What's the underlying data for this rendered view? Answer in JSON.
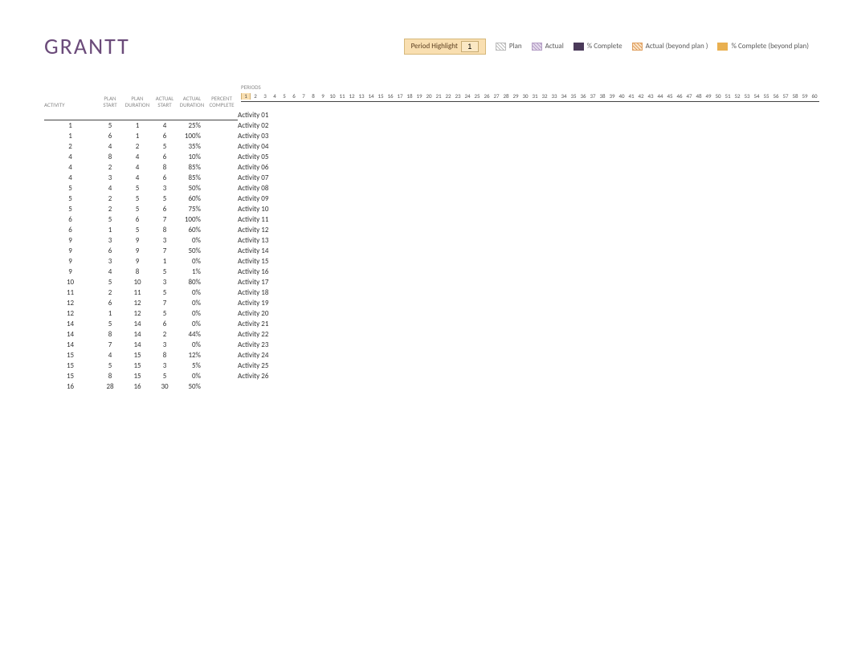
{
  "title": "GRANTT",
  "legend": {
    "highlight_label": "Period Highlight",
    "highlight_value": "1",
    "items": [
      {
        "swatch": "sw-plan",
        "label": "Plan"
      },
      {
        "swatch": "sw-actual",
        "label": "Actual"
      },
      {
        "swatch": "sw-complete",
        "label": "% Complete"
      },
      {
        "swatch": "sw-actual-beyond",
        "label": "Actual (beyond plan )"
      },
      {
        "swatch": "sw-complete-beyond",
        "label": "% Complete (beyond plan)"
      }
    ]
  },
  "columns": {
    "activity": "ACTIVITY",
    "plan_start": "PLAN\nSTART",
    "plan_duration": "PLAN\nDURATION",
    "actual_start": "ACTUAL\nSTART",
    "actual_duration": "ACTUAL\nDURATION",
    "percent_complete": "PERCENT\nCOMPLETE",
    "periods": "PERIODS"
  },
  "periods_count": 60,
  "highlight_period": 1,
  "rows": [
    {
      "activity": "Activity 01",
      "plan_start": "1",
      "plan_duration": "5",
      "actual_start": "1",
      "actual_duration": "4",
      "percent": "25%"
    },
    {
      "activity": "Activity 02",
      "plan_start": "1",
      "plan_duration": "6",
      "actual_start": "1",
      "actual_duration": "6",
      "percent": "100%"
    },
    {
      "activity": "Activity 03",
      "plan_start": "2",
      "plan_duration": "4",
      "actual_start": "2",
      "actual_duration": "5",
      "percent": "35%"
    },
    {
      "activity": "Activity 04",
      "plan_start": "4",
      "plan_duration": "8",
      "actual_start": "4",
      "actual_duration": "6",
      "percent": "10%"
    },
    {
      "activity": "Activity 05",
      "plan_start": "4",
      "plan_duration": "2",
      "actual_start": "4",
      "actual_duration": "8",
      "percent": "85%"
    },
    {
      "activity": "Activity 06",
      "plan_start": "4",
      "plan_duration": "3",
      "actual_start": "4",
      "actual_duration": "6",
      "percent": "85%"
    },
    {
      "activity": "Activity 07",
      "plan_start": "5",
      "plan_duration": "4",
      "actual_start": "5",
      "actual_duration": "3",
      "percent": "50%"
    },
    {
      "activity": "Activity 08",
      "plan_start": "5",
      "plan_duration": "2",
      "actual_start": "5",
      "actual_duration": "5",
      "percent": "60%"
    },
    {
      "activity": "Activity 09",
      "plan_start": "5",
      "plan_duration": "2",
      "actual_start": "5",
      "actual_duration": "6",
      "percent": "75%"
    },
    {
      "activity": "Activity 10",
      "plan_start": "6",
      "plan_duration": "5",
      "actual_start": "6",
      "actual_duration": "7",
      "percent": "100%"
    },
    {
      "activity": "Activity 11",
      "plan_start": "6",
      "plan_duration": "1",
      "actual_start": "5",
      "actual_duration": "8",
      "percent": "60%"
    },
    {
      "activity": "Activity 12",
      "plan_start": "9",
      "plan_duration": "3",
      "actual_start": "9",
      "actual_duration": "3",
      "percent": "0%"
    },
    {
      "activity": "Activity 13",
      "plan_start": "9",
      "plan_duration": "6",
      "actual_start": "9",
      "actual_duration": "7",
      "percent": "50%"
    },
    {
      "activity": "Activity 14",
      "plan_start": "9",
      "plan_duration": "3",
      "actual_start": "9",
      "actual_duration": "1",
      "percent": "0%"
    },
    {
      "activity": "Activity 15",
      "plan_start": "9",
      "plan_duration": "4",
      "actual_start": "8",
      "actual_duration": "5",
      "percent": "1%"
    },
    {
      "activity": "Activity 16",
      "plan_start": "10",
      "plan_duration": "5",
      "actual_start": "10",
      "actual_duration": "3",
      "percent": "80%"
    },
    {
      "activity": "Activity 17",
      "plan_start": "11",
      "plan_duration": "2",
      "actual_start": "11",
      "actual_duration": "5",
      "percent": "0%"
    },
    {
      "activity": "Activity 18",
      "plan_start": "12",
      "plan_duration": "6",
      "actual_start": "12",
      "actual_duration": "7",
      "percent": "0%"
    },
    {
      "activity": "Activity 19",
      "plan_start": "12",
      "plan_duration": "1",
      "actual_start": "12",
      "actual_duration": "5",
      "percent": "0%"
    },
    {
      "activity": "Activity 20",
      "plan_start": "14",
      "plan_duration": "5",
      "actual_start": "14",
      "actual_duration": "6",
      "percent": "0%"
    },
    {
      "activity": "Activity 21",
      "plan_start": "14",
      "plan_duration": "8",
      "actual_start": "14",
      "actual_duration": "2",
      "percent": "44%"
    },
    {
      "activity": "Activity 22",
      "plan_start": "14",
      "plan_duration": "7",
      "actual_start": "14",
      "actual_duration": "3",
      "percent": "0%"
    },
    {
      "activity": "Activity 23",
      "plan_start": "15",
      "plan_duration": "4",
      "actual_start": "15",
      "actual_duration": "8",
      "percent": "12%"
    },
    {
      "activity": "Activity 24",
      "plan_start": "15",
      "plan_duration": "5",
      "actual_start": "15",
      "actual_duration": "3",
      "percent": "5%"
    },
    {
      "activity": "Activity 25",
      "plan_start": "15",
      "plan_duration": "8",
      "actual_start": "15",
      "actual_duration": "5",
      "percent": "0%"
    },
    {
      "activity": "Activity 26",
      "plan_start": "16",
      "plan_duration": "28",
      "actual_start": "16",
      "actual_duration": "30",
      "percent": "50%"
    }
  ]
}
